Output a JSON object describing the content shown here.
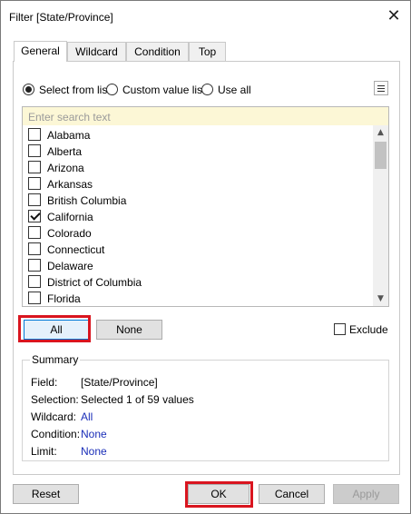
{
  "dialog": {
    "title": "Filter [State/Province]",
    "close_glyph": "✕"
  },
  "tabs": [
    {
      "label": "General",
      "active": true
    },
    {
      "label": "Wildcard",
      "active": false
    },
    {
      "label": "Condition",
      "active": false
    },
    {
      "label": "Top",
      "active": false
    }
  ],
  "selection_mode": {
    "options": [
      {
        "label": "Select from list",
        "selected": true
      },
      {
        "label": "Custom value list",
        "selected": false
      },
      {
        "label": "Use all",
        "selected": false
      }
    ],
    "menu_icon": "list-menu-icon"
  },
  "search": {
    "placeholder": "Enter search text",
    "value": ""
  },
  "list": {
    "items": [
      {
        "label": "Alabama",
        "checked": false
      },
      {
        "label": "Alberta",
        "checked": false
      },
      {
        "label": "Arizona",
        "checked": false
      },
      {
        "label": "Arkansas",
        "checked": false
      },
      {
        "label": "British Columbia",
        "checked": false
      },
      {
        "label": "California",
        "checked": true
      },
      {
        "label": "Colorado",
        "checked": false
      },
      {
        "label": "Connecticut",
        "checked": false
      },
      {
        "label": "Delaware",
        "checked": false
      },
      {
        "label": "District of Columbia",
        "checked": false
      },
      {
        "label": "Florida",
        "checked": false
      }
    ],
    "scroll_up_glyph": "▲",
    "scroll_down_glyph": "▼"
  },
  "list_actions": {
    "all_label": "All",
    "none_label": "None",
    "exclude_label": "Exclude",
    "exclude_checked": false
  },
  "summary": {
    "title": "Summary",
    "rows": [
      {
        "key": "Field:",
        "value": "[State/Province]",
        "link": false
      },
      {
        "key": "Selection:",
        "value": "Selected 1 of 59 values",
        "link": false
      },
      {
        "key": "Wildcard:",
        "value": "All",
        "link": true
      },
      {
        "key": "Condition:",
        "value": "None",
        "link": true
      },
      {
        "key": "Limit:",
        "value": "None",
        "link": true
      }
    ]
  },
  "footer": {
    "reset_label": "Reset",
    "ok_label": "OK",
    "cancel_label": "Cancel",
    "apply_label": "Apply"
  },
  "colors": {
    "highlight": "#d9151f",
    "link": "#1a2eb8",
    "search_background": "#fcf7d6"
  }
}
